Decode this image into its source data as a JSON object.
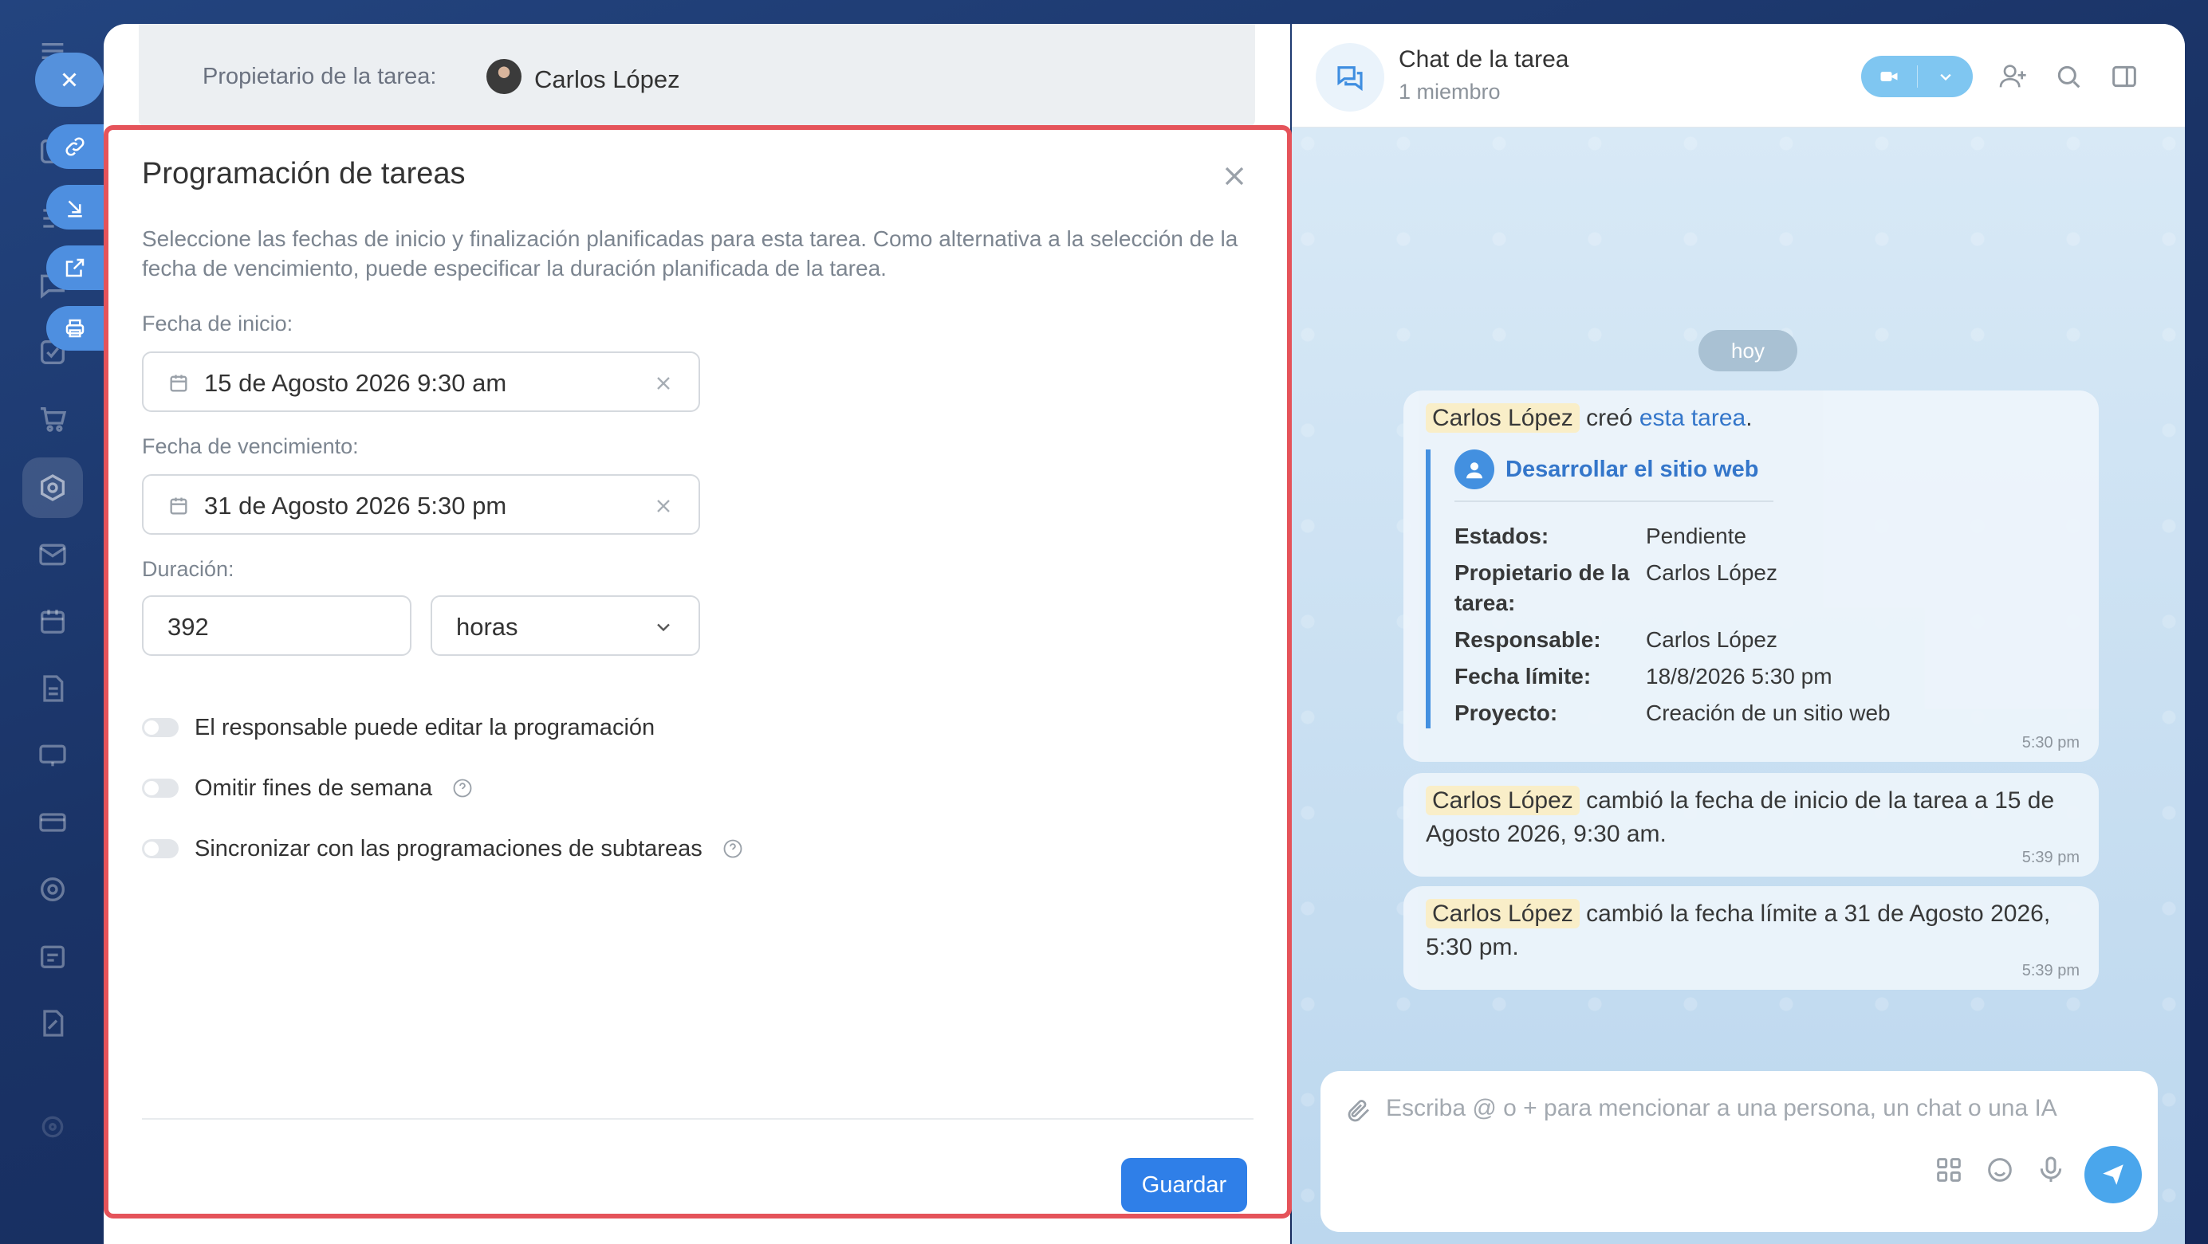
{
  "task_header": {
    "owner_label": "Propietario de la tarea:",
    "owner_name": "Carlos López"
  },
  "modal": {
    "title": "Programación de tareas",
    "description": "Seleccione las fechas de inicio y finalización planificadas para esta tarea. Como alternativa a la selección de la fecha de vencimiento, puede especificar la duración planificada de la tarea.",
    "start_label": "Fecha de inicio:",
    "start_value": "15 de Agosto 2026 9:30 am",
    "due_label": "Fecha de vencimiento:",
    "due_value": "31 de Agosto 2026 5:30 pm",
    "duration_label": "Duración:",
    "duration_value": "392",
    "duration_unit": "horas",
    "toggle_edit": "El responsable puede editar la programación",
    "toggle_weekends": "Omitir fines de semana",
    "toggle_subtasks": "Sincronizar con las programaciones de subtareas",
    "save_label": "Guardar"
  },
  "chat": {
    "title": "Chat de la tarea",
    "subtitle": "1 miembro",
    "date_divider": "hoy",
    "messages": [
      {
        "author": "Carlos López",
        "verb": "creó",
        "link": "esta tarea",
        "suffix": ".",
        "card_title": "Desarrollar el sitio web",
        "fields": [
          {
            "k": "Estados:",
            "v": "Pendiente"
          },
          {
            "k": "Propietario de la tarea:",
            "v": "Carlos López"
          },
          {
            "k": "Responsable:",
            "v": "Carlos López"
          },
          {
            "k": "Fecha límite:",
            "v": "18/8/2026 5:30 pm"
          },
          {
            "k": "Proyecto:",
            "v": "Creación de un sitio web"
          }
        ],
        "time": "5:30 pm"
      },
      {
        "author": "Carlos López",
        "text": "cambió la fecha de inicio de la tarea a 15 de Agosto 2026, 9:30 am.",
        "time": "5:39 pm"
      },
      {
        "author": "Carlos López",
        "text": "cambió la fecha límite a 31 de Agosto 2026, 5:30 pm.",
        "time": "5:39 pm"
      }
    ],
    "composer_placeholder": "Escriba @ o + para mencionar a una persona, un chat o una IA"
  },
  "colors": {
    "accent": "#2f7fe8",
    "highlight_border": "#e5535a",
    "chat_bg": "#cfe3f3",
    "name_chip": "#fbefc7"
  }
}
